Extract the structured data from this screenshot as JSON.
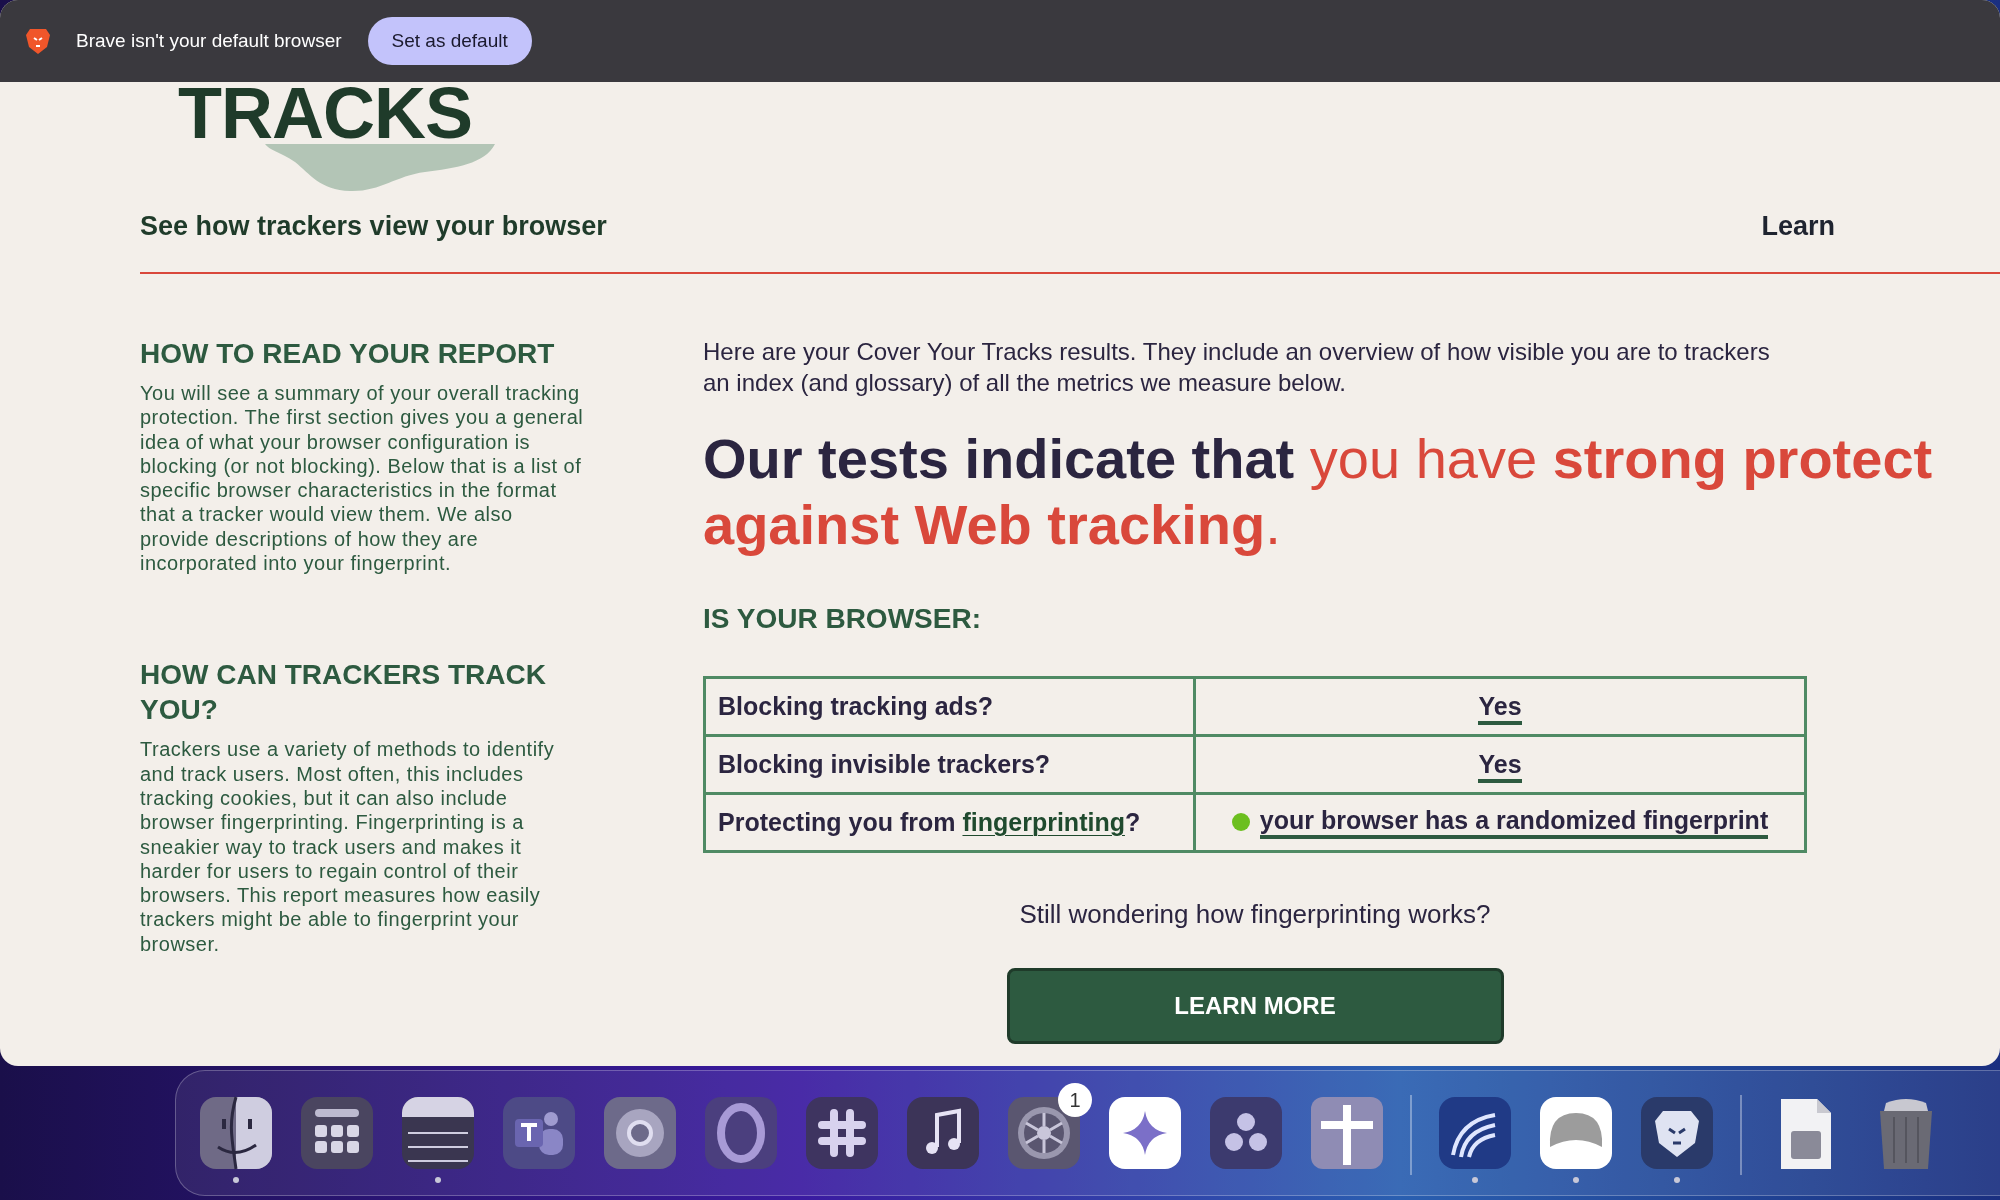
{
  "notification_bar": {
    "message": "Brave isn't your default browser",
    "button": "Set as default"
  },
  "logo": {
    "text": "TRACKS"
  },
  "header": {
    "subtitle": "See how trackers view your browser",
    "nav_link": "Learn"
  },
  "sidebar": {
    "sections": [
      {
        "heading": "HOW TO READ YOUR REPORT",
        "body": "You will see a summary of your overall tracking protection. The first section gives you a general idea of what your browser configuration is blocking (or not blocking). Below that is a list of specific browser characteristics in the format that a tracker would view them. We also provide descriptions of how they are incorporated into your fingerprint."
      },
      {
        "heading": "HOW CAN TRACKERS TRACK YOU?",
        "body": "Trackers use a variety of methods to identify and track users. Most often, this includes tracking cookies, but it can also include browser fingerprinting. Fingerprinting is a sneakier way to track users and makes it harder for users to regain control of their browsers. This report measures how easily trackers might be able to fingerprint your browser."
      }
    ]
  },
  "intro": {
    "lines": [
      "Here are your Cover Your Tracks results. They include an overview of how visible you are to trackers",
      "an index (and glossary) of all the metrics we measure below."
    ]
  },
  "verdict": {
    "lines": [
      [
        {
          "text": "Our tests indicate that ",
          "kind": "plain"
        },
        {
          "text": "you have ",
          "kind": "light"
        },
        {
          "text": "strong protect",
          "kind": "emphasis"
        }
      ],
      [
        {
          "text": "against Web tracking",
          "kind": "emphasis"
        },
        {
          "text": ".",
          "kind": "light"
        }
      ]
    ]
  },
  "results": {
    "heading": "IS YOUR BROWSER:",
    "rows": [
      {
        "question": {
          "text": "Blocking tracking ads?"
        },
        "answer": {
          "text": "Yes"
        }
      },
      {
        "question": {
          "text": "Blocking invisible trackers?"
        },
        "answer": {
          "text": "Yes"
        }
      },
      {
        "question": {
          "text": "Protecting you from ",
          "link": "fingerprinting",
          "after": "?"
        },
        "answer": {
          "text": "your browser has a randomized fingerprint",
          "color": "#6cbf1f"
        }
      }
    ]
  },
  "learn_more": {
    "prompt": "Still wondering how fingerprinting works?",
    "button": "LEARN MORE"
  },
  "dock": {
    "items": [
      {
        "kind": "finder",
        "running": true
      },
      {
        "kind": "launchpad",
        "running": false
      },
      {
        "kind": "notes",
        "running": true
      },
      {
        "kind": "teams",
        "running": false
      },
      {
        "kind": "chrome",
        "running": false
      },
      {
        "kind": "opera",
        "running": false
      },
      {
        "kind": "slack",
        "running": false
      },
      {
        "kind": "music",
        "running": false
      },
      {
        "kind": "settings",
        "running": false,
        "badge": "1"
      },
      {
        "kind": "sparkle",
        "running": false
      },
      {
        "kind": "dots",
        "running": false
      },
      {
        "kind": "cross",
        "running": false
      },
      {
        "kind": "divider"
      },
      {
        "kind": "wave",
        "running": true
      },
      {
        "kind": "blob",
        "running": true
      },
      {
        "kind": "lion",
        "running": true
      },
      {
        "kind": "divider"
      },
      {
        "kind": "document",
        "running": false
      },
      {
        "kind": "trash",
        "running": false
      }
    ]
  }
}
